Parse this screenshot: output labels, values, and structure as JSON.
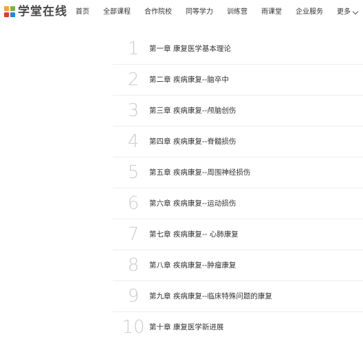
{
  "brand": {
    "name": "学堂在线",
    "logo_icon": "xuetang-grid-logo-icon",
    "logo_colors": [
      "#f5a623",
      "#7cb342",
      "#e53935",
      "#1e88e5"
    ]
  },
  "nav": {
    "items": [
      {
        "label": "首页"
      },
      {
        "label": "全部课程"
      },
      {
        "label": "合作院校"
      },
      {
        "label": "同等学力"
      },
      {
        "label": "训练营"
      },
      {
        "label": "雨课堂"
      },
      {
        "label": "企业服务"
      }
    ],
    "more_label": "更多",
    "more_icon": "chevron-down-icon"
  },
  "chapters": [
    {
      "number": "1",
      "title": "第一章 康复医学基本理论"
    },
    {
      "number": "2",
      "title": "第二章 疾病康复--脑卒中"
    },
    {
      "number": "3",
      "title": "第三章 疾病康复--颅脑创伤"
    },
    {
      "number": "4",
      "title": "第四章 疾病康复--脊髓损伤"
    },
    {
      "number": "5",
      "title": "第五章 疾病康复--周围神经损伤"
    },
    {
      "number": "6",
      "title": "第六章 疾病康复--运动损伤"
    },
    {
      "number": "7",
      "title": "第七章 疾病康复-- 心肺康复"
    },
    {
      "number": "8",
      "title": "第八章 疾病康复--肿瘤康复"
    },
    {
      "number": "9",
      "title": "第九章 疾病康复--临床特殊问题的康复"
    },
    {
      "number": "10",
      "title": "第十章 康复医学新进展"
    }
  ]
}
